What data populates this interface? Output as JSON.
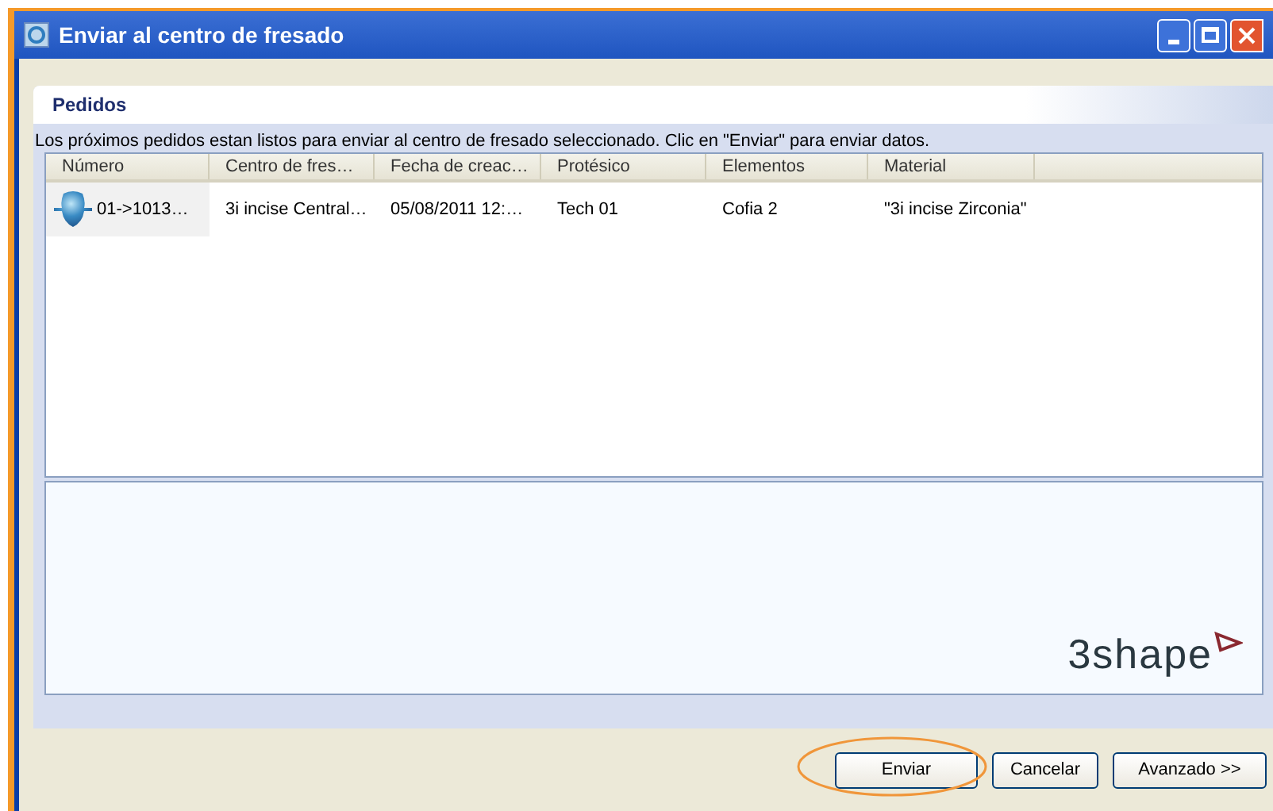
{
  "window": {
    "title": "Enviar al centro de fresado"
  },
  "section": {
    "title": "Pedidos"
  },
  "description": "Los próximos pedidos estan listos para enviar al centro de fresado seleccionado. Clic en \"Enviar\" para enviar datos.",
  "table": {
    "columns": [
      "Número",
      "Centro de fres…",
      "Fecha de creac…",
      "Protésico",
      "Elementos",
      "Material"
    ],
    "rows": [
      {
        "selected": true,
        "cells": [
          "01->1013…",
          "3i incise Central…",
          "05/08/2011 12:…",
          "Tech 01",
          "Cofia 2",
          "\"3i incise Zirconia\""
        ]
      }
    ]
  },
  "logo": "3shape",
  "buttons": [
    {
      "label": "Enviar",
      "highlighted": true
    },
    {
      "label": "Cancelar",
      "highlighted": false
    },
    {
      "label": "Avanzado >>",
      "highlighted": false
    }
  ]
}
